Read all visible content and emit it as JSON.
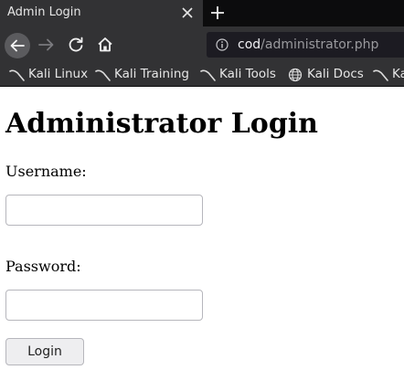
{
  "browser": {
    "tab": {
      "title": "Admin Login",
      "close_icon": "close-icon"
    },
    "newtab_icon": "plus-icon",
    "nav": {
      "back_icon": "arrow-left-icon",
      "forward_icon": "arrow-right-icon",
      "reload_icon": "reload-icon",
      "home_icon": "home-icon"
    },
    "urlbar": {
      "info_icon": "info-icon",
      "host": "cod",
      "path": "/administrator.php"
    },
    "bookmarks": [
      {
        "label": "Kali Linux",
        "icon": "kali-dragon-icon"
      },
      {
        "label": "Kali Training",
        "icon": "kali-dragon-icon"
      },
      {
        "label": "Kali Tools",
        "icon": "kali-dragon-icon"
      },
      {
        "label": "Kali Docs",
        "icon": "globe-icon"
      },
      {
        "label": "Ka",
        "icon": "kali-dragon-icon"
      }
    ],
    "colors": {
      "chrome": "#323234",
      "tabstrip": "#0c0c0d",
      "urlbar": "#1c1b22"
    }
  },
  "page": {
    "title": "Administrator Login",
    "username": {
      "label": "Username:",
      "value": ""
    },
    "password": {
      "label": "Password:",
      "value": ""
    },
    "login_button": "Login"
  }
}
